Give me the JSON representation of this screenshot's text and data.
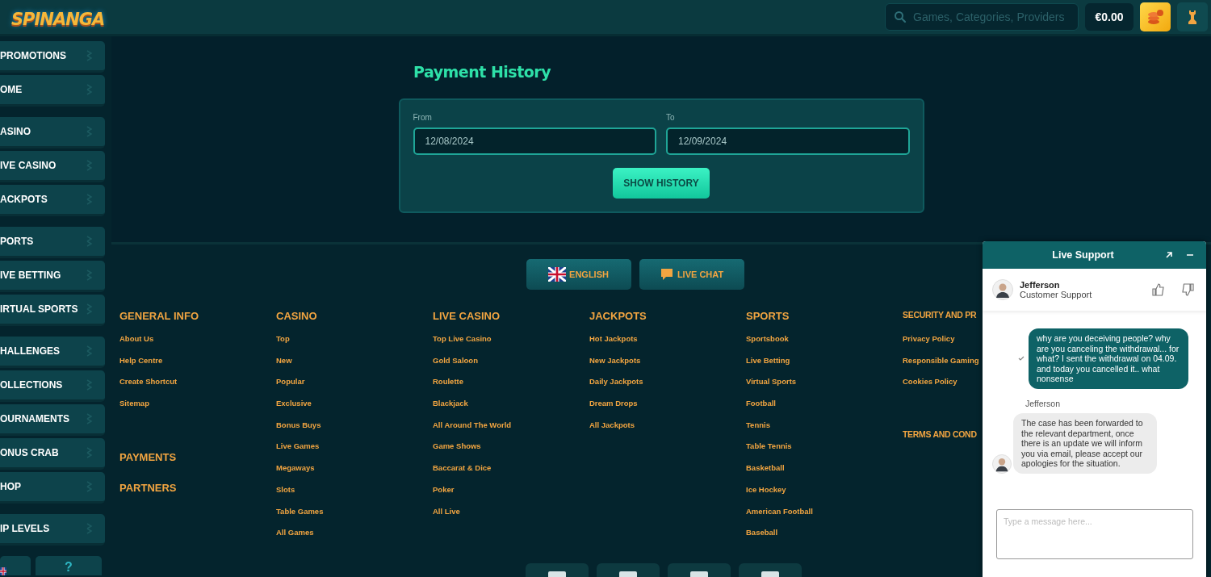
{
  "header": {
    "logo": "SPINANGA",
    "search": {
      "placeholder": "Games, Categories, Providers"
    },
    "balance": "€0.00"
  },
  "sidebar": {
    "groups": [
      {
        "items": [
          "PROMOTIONS",
          "OME"
        ]
      },
      {
        "items": [
          "ASINO",
          "IVE CASINO",
          "ACKPOTS"
        ]
      },
      {
        "items": [
          "PORTS",
          "IVE BETTING",
          "IRTUAL SPORTS"
        ]
      },
      {
        "items": [
          "HALLENGES",
          "OLLECTIONS",
          "OURNAMENTS",
          "ONUS CRAB",
          "HOP"
        ]
      },
      {
        "items": [
          "IP LEVELS"
        ]
      }
    ],
    "help": "?"
  },
  "payment_history": {
    "title": "Payment History",
    "from": {
      "label": "From",
      "value": "12/08/2024"
    },
    "to": {
      "label": "To",
      "value": "12/09/2024"
    },
    "button": "SHOW HISTORY"
  },
  "footer": {
    "language_button": "ENGLISH",
    "chat_button": "LIVE CHAT",
    "columns": [
      {
        "sections": [
          {
            "title": "GENERAL INFO",
            "links": [
              "About Us",
              "Help Centre",
              "Create Shortcut",
              "Sitemap"
            ]
          },
          {
            "title": "PAYMENTS"
          },
          {
            "title": "PARTNERS"
          }
        ]
      },
      {
        "sections": [
          {
            "title": "CASINO",
            "links": [
              "Top",
              "New",
              "Popular",
              "Exclusive",
              "Bonus Buys",
              "Live Games",
              "Megaways",
              "Slots",
              "Table Games",
              "All Games"
            ]
          }
        ]
      },
      {
        "sections": [
          {
            "title": "LIVE CASINO",
            "links": [
              "Top Live Casino",
              "Gold Saloon",
              "Roulette",
              "Blackjack",
              "All Around The World",
              "Game Shows",
              "Baccarat & Dice",
              "Poker",
              "All Live"
            ]
          }
        ]
      },
      {
        "sections": [
          {
            "title": "JACKPOTS",
            "links": [
              "Hot Jackpots",
              "New Jackpots",
              "Daily Jackpots",
              "Dream Drops",
              "All Jackpots"
            ]
          }
        ]
      },
      {
        "sections": [
          {
            "title": "SPORTS",
            "links": [
              "Sportsbook",
              "Live Betting",
              "Virtual Sports",
              "Football",
              "Tennis",
              "Table Tennis",
              "Basketball",
              "Ice Hockey",
              "American Football",
              "Baseball"
            ]
          }
        ]
      },
      {
        "sections": [
          {
            "title": "SECURITY AND PR",
            "links": [
              "Privacy Policy",
              "Responsible Gaming",
              "Cookies Policy"
            ]
          },
          {
            "title": "TERMS AND COND"
          }
        ]
      }
    ],
    "payment_methods": [
      {
        "kind": "logo"
      },
      {
        "kind": "logo"
      },
      {
        "kind": "logo"
      },
      {
        "kind": "logo"
      }
    ]
  },
  "chat": {
    "title": "Live Support",
    "agent": {
      "name": "Jefferson",
      "role": "Customer Support"
    },
    "messages": [
      {
        "kind": "user",
        "text": "why are you deceiving people? why are you canceling the withdrawal... for what? I sent the withdrawal on 04.09. and today you cancelled it.. what nonsense"
      },
      {
        "kind": "sender",
        "text": "Jefferson"
      },
      {
        "kind": "agent",
        "text": "The case has been forwarded to the relevant department, once there is an update we will inform you via email, please accept our apologies for the situation."
      }
    ],
    "input": {
      "placeholder": "Type a message here..."
    }
  }
}
